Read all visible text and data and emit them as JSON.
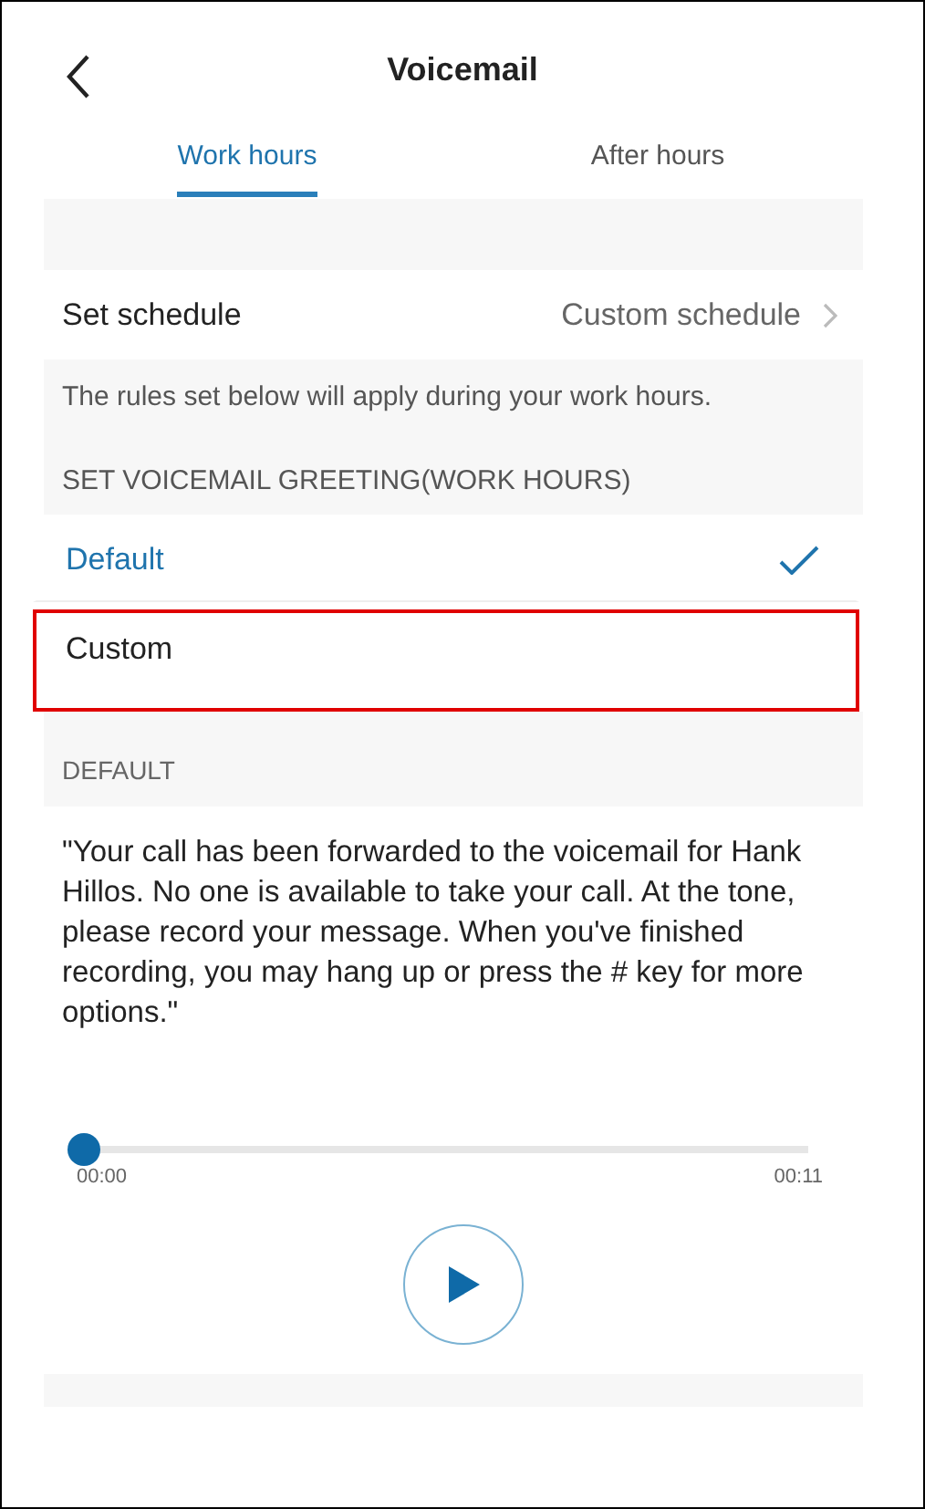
{
  "header": {
    "title": "Voicemail"
  },
  "tabs": [
    {
      "label": "Work hours",
      "selected": true
    },
    {
      "label": "After hours",
      "selected": false
    }
  ],
  "schedule": {
    "label": "Set schedule",
    "value": "Custom schedule"
  },
  "info": "The rules set below will apply during your work hours.",
  "greeting_section": "SET VOICEMAIL GREETING(WORK HOURS)",
  "greeting_options": [
    {
      "label": "Default",
      "selected": true,
      "highlighted": false
    },
    {
      "label": "Custom",
      "selected": false,
      "highlighted": true
    }
  ],
  "default_section": "DEFAULT",
  "greeting_text": "\"Your call has been forwarded to the voicemail for Hank Hillos. No one is available to take your call. At the tone, please record your message. When you've finished recording, you may hang up or press the # key for more options.\"",
  "player": {
    "level": 0,
    "elapsed": "00:00",
    "duration": "00:11"
  }
}
